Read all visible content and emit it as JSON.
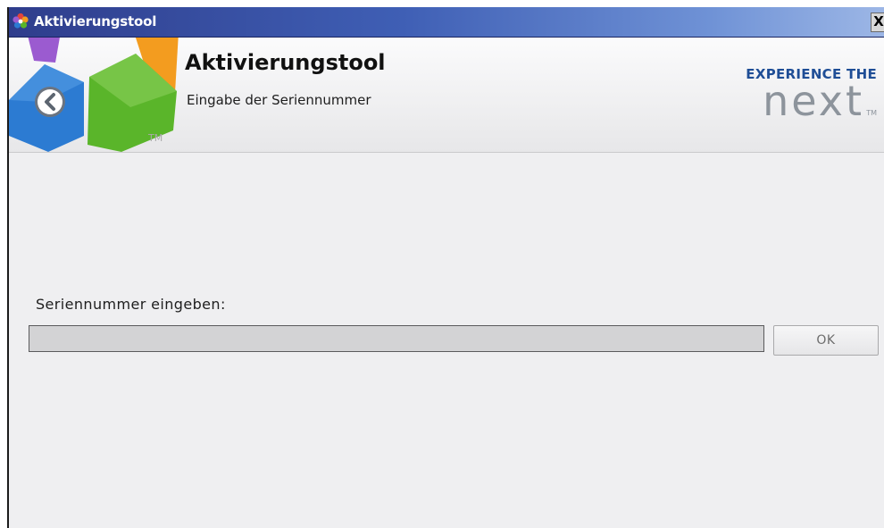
{
  "window": {
    "title": "Aktivierungstool"
  },
  "titlebar": {
    "close_label": "X"
  },
  "header": {
    "title": "Aktivierungstool",
    "subtitle": "Eingabe der Seriennummer",
    "logo_tm": "TM",
    "brand": {
      "top": "EXPERIENCE THE",
      "word": "next",
      "tm": "TM"
    }
  },
  "form": {
    "serial_label": "Seriennummer eingeben:",
    "serial_value": "",
    "ok_label": "OK"
  },
  "icons": {
    "app": "app-flower-icon",
    "back": "back-chevron-icon"
  },
  "colors": {
    "titlebar_start": "#2f3d8c",
    "titlebar_end": "#9db7e6",
    "brand_blue": "#1f4e96",
    "brand_gray": "#8d949c",
    "logo_blue": "#2c7bd2",
    "logo_green": "#5ab52a",
    "logo_orange": "#f39c1f",
    "logo_purple": "#9b5bd0"
  }
}
